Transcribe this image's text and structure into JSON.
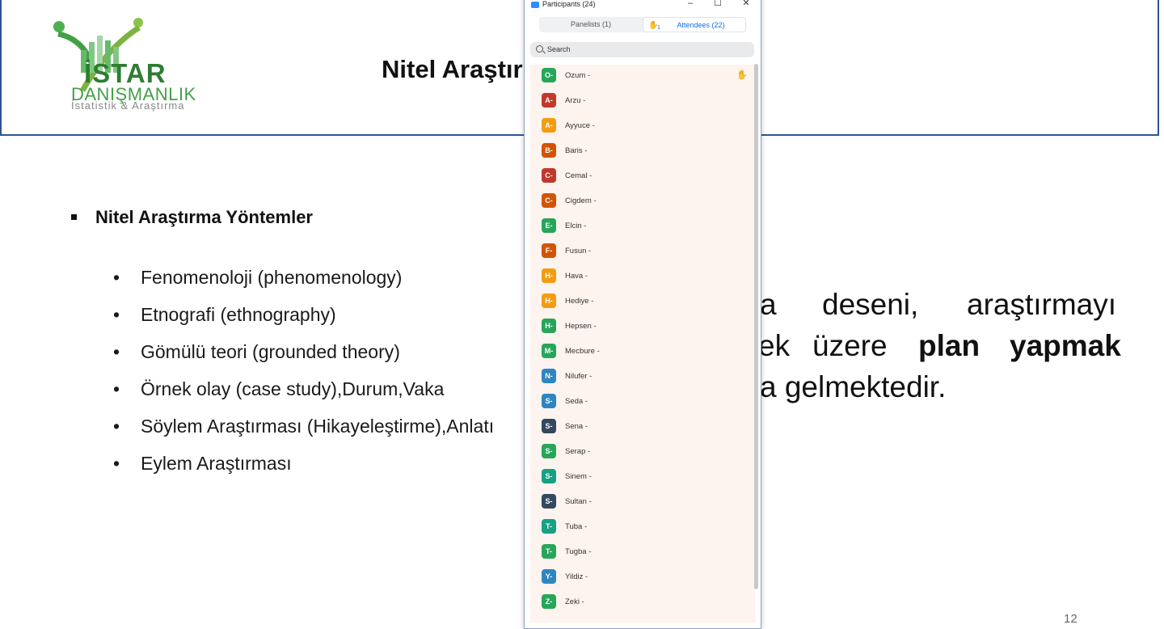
{
  "slide": {
    "title": "Nitel Araştırma",
    "logo_main": "İSTAR",
    "logo_sub": "DANIŞMANLIK",
    "logo_tag": "İstatistik & Araştırma",
    "section_heading": "Nitel Araştırma Yöntemler",
    "bullets": [
      "Fenomenoloji (phenomenology)",
      "Etnografi (ethnography)",
      "Gömülü teori (grounded theory)",
      "Örnek olay (case study),Durum,Vaka",
      "Söylem  Araştırması (Hikayeleştirme),Anlatı"
    ],
    "bullet_last": "Eylem Araştırması",
    "right_line1_a": "a",
    "right_line1_b": "deseni,",
    "right_line1_c": "araştırmayı",
    "right_line2_a": "ek",
    "right_line2_b": "üzere",
    "right_line2_c": "plan",
    "right_line2_d": "yapmak",
    "right_line3": "a gelmektedir.",
    "page_number": "12"
  },
  "zoom": {
    "window_title": "Participants (24)",
    "minimize": "–",
    "maximize": "☐",
    "close": "✕",
    "tab_panelists": "Panelists (1)",
    "hand_count": "1",
    "tab_attendees": "Attendees (22)",
    "search_placeholder": "Search",
    "participants": [
      {
        "initial": "O-",
        "name": "Ozum -",
        "color": "#27a65a",
        "raised_hand": true
      },
      {
        "initial": "A-",
        "name": "Arzu -",
        "color": "#c0392b"
      },
      {
        "initial": "A-",
        "name": "Ayyuce -",
        "color": "#f39c12"
      },
      {
        "initial": "B-",
        "name": "Baris -",
        "color": "#d35400"
      },
      {
        "initial": "C-",
        "name": "Cemal -",
        "color": "#c0392b"
      },
      {
        "initial": "C-",
        "name": "Cigdem -",
        "color": "#d35400"
      },
      {
        "initial": "E-",
        "name": "Elcin -",
        "color": "#27a65a"
      },
      {
        "initial": "F-",
        "name": "Fusun -",
        "color": "#d35400"
      },
      {
        "initial": "H-",
        "name": "Hava -",
        "color": "#f39c12"
      },
      {
        "initial": "H-",
        "name": "Hediye -",
        "color": "#f39c12"
      },
      {
        "initial": "H-",
        "name": "Hepsen -",
        "color": "#27a65a"
      },
      {
        "initial": "M-",
        "name": "Mecbure -",
        "color": "#27a65a"
      },
      {
        "initial": "N-",
        "name": "Nilufer -",
        "color": "#2e86c1"
      },
      {
        "initial": "S-",
        "name": "Seda -",
        "color": "#2e86c1"
      },
      {
        "initial": "S-",
        "name": "Sena -",
        "color": "#34495e"
      },
      {
        "initial": "S-",
        "name": "Serap -",
        "color": "#27a65a"
      },
      {
        "initial": "S-",
        "name": "Sinem -",
        "color": "#16a085"
      },
      {
        "initial": "S-",
        "name": "Sultan -",
        "color": "#34495e"
      },
      {
        "initial": "T-",
        "name": "Tuba -",
        "color": "#16a085"
      },
      {
        "initial": "T-",
        "name": "Tugba -",
        "color": "#27a65a"
      },
      {
        "initial": "Y-",
        "name": "Yildiz -",
        "color": "#2e86c1"
      },
      {
        "initial": "Z-",
        "name": "Zeki -",
        "color": "#27a65a"
      }
    ]
  }
}
